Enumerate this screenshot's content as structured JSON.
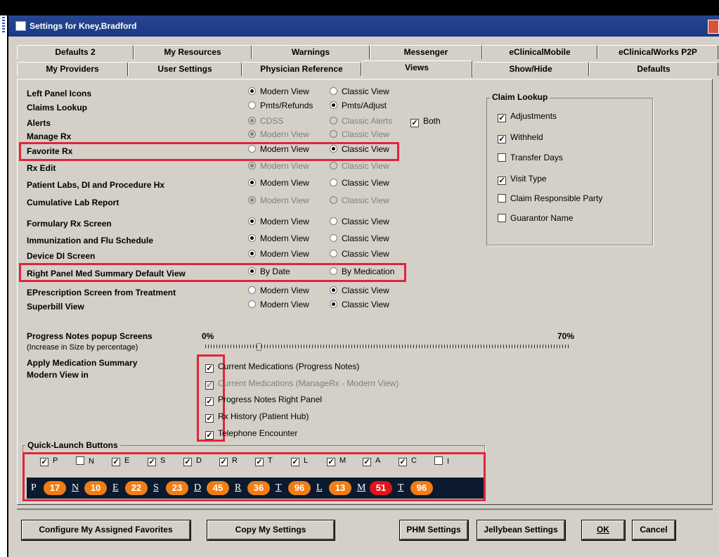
{
  "window": {
    "title": "Settings for Kney,Bradford"
  },
  "tabs_row1": [
    "Defaults 2",
    "My Resources",
    "Warnings",
    "Messenger",
    "eClinicalMobile",
    "eClinicalWorks P2P"
  ],
  "tabs_row2": [
    "My Providers",
    "User Settings",
    "Physician Reference",
    "Views",
    "Show/Hide",
    "Defaults"
  ],
  "active_tab": "Views",
  "view_settings": [
    {
      "label": "Left Panel Icons",
      "opt1": "Modern View",
      "opt2": "Classic View",
      "selected": 1,
      "disabled": false
    },
    {
      "label": "Claims Lookup",
      "opt1": "Pmts/Refunds",
      "opt2": "Pmts/Adjust",
      "selected": 2,
      "disabled": false
    },
    {
      "label": "Alerts",
      "opt1": "CDSS",
      "opt2": "Classic Alerts",
      "selected": 1,
      "disabled": true
    },
    {
      "label": "Manage Rx",
      "opt1": "Modern View",
      "opt2": "Classic View",
      "selected": 1,
      "disabled": true
    },
    {
      "label": "Favorite Rx",
      "opt1": "Modern View",
      "opt2": "Classic View",
      "selected": 2,
      "disabled": false
    },
    {
      "label": "Rx Edit",
      "opt1": "Modern View",
      "opt2": "Classic View",
      "selected": 1,
      "disabled": true
    },
    {
      "label": "Patient Labs, DI and Procedure Hx",
      "opt1": "Modern View",
      "opt2": "Classic View",
      "selected": 1,
      "disabled": false
    },
    {
      "label": "Cumulative Lab Report",
      "opt1": "Modern View",
      "opt2": "Classic View",
      "selected": 1,
      "disabled": true
    },
    {
      "label": "Formulary Rx Screen",
      "opt1": "Modern View",
      "opt2": "Classic View",
      "selected": 1,
      "disabled": false
    },
    {
      "label": "Immunization and Flu Schedule",
      "opt1": "Modern View",
      "opt2": "Classic View",
      "selected": 1,
      "disabled": false
    },
    {
      "label": "Device DI Screen",
      "opt1": "Modern View",
      "opt2": "Classic View",
      "selected": 1,
      "disabled": false
    },
    {
      "label": "Right Panel Med Summary Default View",
      "opt1": "By Date",
      "opt2": "By Medication",
      "selected": 1,
      "disabled": false
    },
    {
      "label": "EPrescription Screen from Treatment",
      "opt1": "Modern View",
      "opt2": "Classic View",
      "selected": 2,
      "disabled": false
    },
    {
      "label": "Superbill View",
      "opt1": "Modern View",
      "opt2": "Classic View",
      "selected": 2,
      "disabled": false
    }
  ],
  "alerts_both": {
    "label": "Both",
    "checked": true
  },
  "claim_lookup": {
    "title": "Claim Lookup",
    "items": [
      {
        "label": "Adjustments",
        "checked": true
      },
      {
        "label": "Withheld",
        "checked": true
      },
      {
        "label": "Transfer Days",
        "checked": false
      },
      {
        "label": "Visit Type",
        "checked": true
      },
      {
        "label": "Claim Responsible Party",
        "checked": false
      },
      {
        "label": "Guarantor Name",
        "checked": false
      }
    ]
  },
  "progress_notes": {
    "label": "Progress Notes popup Screens",
    "sublabel": "(Increase in Size by percentage)",
    "min_label": "0%",
    "max_label": "70%",
    "value_fraction": 0.14
  },
  "med_summary": {
    "label1": "Apply Medication Summary",
    "label2": "Modern View in",
    "items": [
      {
        "label": "Current Medications (Progress Notes)",
        "checked": true,
        "disabled": false
      },
      {
        "label": "Current Medications (ManageRx - Modern View)",
        "checked": true,
        "disabled": true
      },
      {
        "label": "Progress Notes Right Panel",
        "checked": true,
        "disabled": false
      },
      {
        "label": "Rx History (Patient Hub)",
        "checked": true,
        "disabled": false
      },
      {
        "label": "Telephone Encounter",
        "checked": true,
        "disabled": false
      }
    ]
  },
  "quick_launch": {
    "title": "Quick-Launch Buttons",
    "checks": [
      {
        "label": "P",
        "checked": true
      },
      {
        "label": "N",
        "checked": false
      },
      {
        "label": "E",
        "checked": true
      },
      {
        "label": "S",
        "checked": true
      },
      {
        "label": "D",
        "checked": true
      },
      {
        "label": "R",
        "checked": true
      },
      {
        "label": "T",
        "checked": true
      },
      {
        "label": "L",
        "checked": true
      },
      {
        "label": "M",
        "checked": true
      },
      {
        "label": "A",
        "checked": true
      },
      {
        "label": "C",
        "checked": true
      },
      {
        "label": "I",
        "checked": false
      }
    ],
    "bar": [
      {
        "letter": "P",
        "count": "17",
        "underline": false
      },
      {
        "letter": "N",
        "count": "10",
        "underline": true
      },
      {
        "letter": "E",
        "count": "22",
        "underline": true
      },
      {
        "letter": "S",
        "count": "23",
        "underline": true
      },
      {
        "letter": "D",
        "count": "45",
        "underline": true
      },
      {
        "letter": "R",
        "count": "36",
        "underline": true
      },
      {
        "letter": "T",
        "count": "96",
        "underline": true
      },
      {
        "letter": "L",
        "count": "13",
        "underline": true
      },
      {
        "letter": "M",
        "count": "51",
        "underline": true,
        "red": true
      },
      {
        "letter": "T",
        "count": "96",
        "underline": true
      }
    ]
  },
  "footer": {
    "configure": "Configure My Assigned Favorites",
    "copy": "Copy My Settings",
    "phm": "PHM Settings",
    "jellybean": "Jellybean Settings",
    "ok": "OK",
    "cancel": "Cancel"
  },
  "colors": {
    "highlight": "#e0253a",
    "title_bar": "#1a3a86",
    "bar_bg": "#0b1a2e",
    "pill": "#f07e15",
    "pill_alert": "#e2131b"
  }
}
